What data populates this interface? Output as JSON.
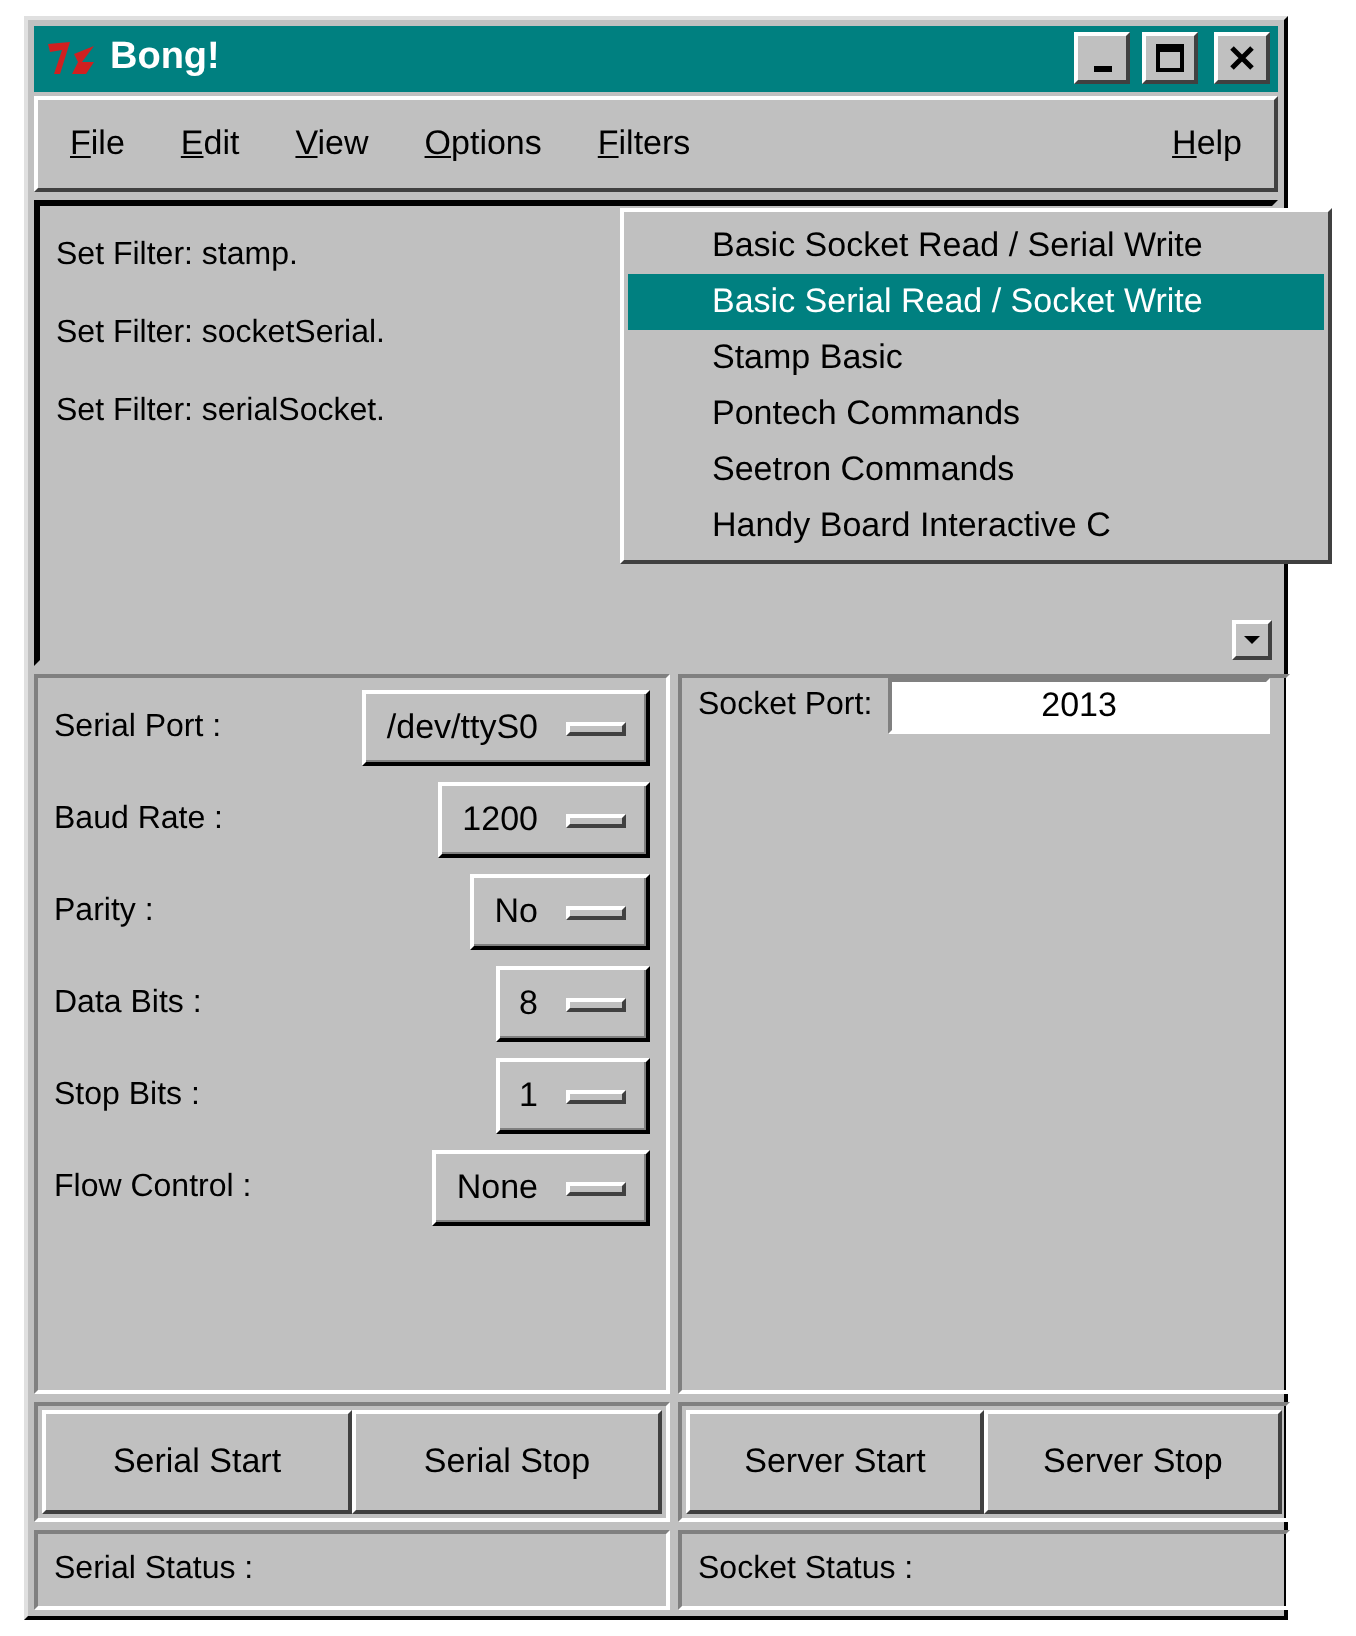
{
  "window": {
    "title": "Bong!"
  },
  "menu_bar": [
    "File",
    "Edit",
    "View",
    "Options",
    "Filters",
    "Help"
  ],
  "log": [
    "Set Filter: stamp.",
    "Set Filter: socketSerial.",
    "Set Filter: serialSocket."
  ],
  "filters_menu": [
    {
      "label": "Basic Socket Read / Serial Write",
      "selected": false
    },
    {
      "label": "Basic Serial Read / Socket Write",
      "selected": true
    },
    {
      "label": "Stamp Basic",
      "selected": false
    },
    {
      "label": "Pontech Commands",
      "selected": false
    },
    {
      "label": "Seetron Commands",
      "selected": false
    },
    {
      "label": "Handy Board Interactive C",
      "selected": false
    }
  ],
  "serial_settings": [
    {
      "label": "Serial Port :",
      "value": "/dev/ttyS0"
    },
    {
      "label": "Baud Rate :",
      "value": "1200"
    },
    {
      "label": "Parity :",
      "value": "No"
    },
    {
      "label": "Data Bits :",
      "value": "8"
    },
    {
      "label": "Stop Bits :",
      "value": "1"
    },
    {
      "label": "Flow Control :",
      "value": "None"
    }
  ],
  "socket_port": {
    "label": "Socket Port:",
    "value": "2013"
  },
  "serial_buttons": [
    "Serial Start",
    "Serial Stop"
  ],
  "server_buttons": [
    "Server Start",
    "Server Stop"
  ],
  "status": {
    "serial": "Serial Status :",
    "socket": "Socket Status :"
  }
}
